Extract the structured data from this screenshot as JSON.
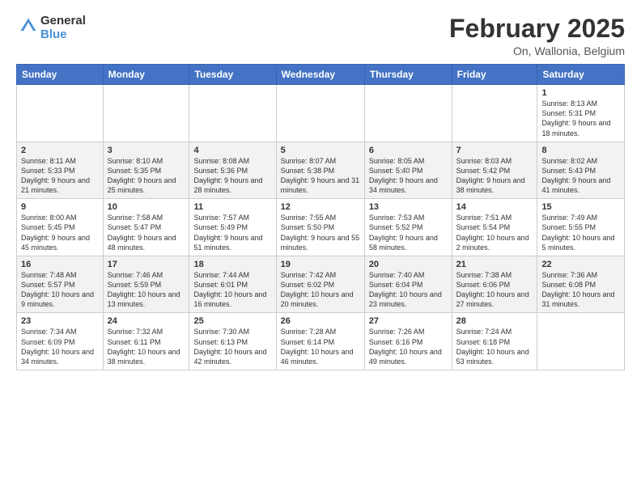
{
  "header": {
    "logo_general": "General",
    "logo_blue": "Blue",
    "month_title": "February 2025",
    "location": "On, Wallonia, Belgium"
  },
  "days_of_week": [
    "Sunday",
    "Monday",
    "Tuesday",
    "Wednesday",
    "Thursday",
    "Friday",
    "Saturday"
  ],
  "weeks": [
    [
      {
        "day": "",
        "info": ""
      },
      {
        "day": "",
        "info": ""
      },
      {
        "day": "",
        "info": ""
      },
      {
        "day": "",
        "info": ""
      },
      {
        "day": "",
        "info": ""
      },
      {
        "day": "",
        "info": ""
      },
      {
        "day": "1",
        "info": "Sunrise: 8:13 AM\nSunset: 5:31 PM\nDaylight: 9 hours and 18 minutes."
      }
    ],
    [
      {
        "day": "2",
        "info": "Sunrise: 8:11 AM\nSunset: 5:33 PM\nDaylight: 9 hours and 21 minutes."
      },
      {
        "day": "3",
        "info": "Sunrise: 8:10 AM\nSunset: 5:35 PM\nDaylight: 9 hours and 25 minutes."
      },
      {
        "day": "4",
        "info": "Sunrise: 8:08 AM\nSunset: 5:36 PM\nDaylight: 9 hours and 28 minutes."
      },
      {
        "day": "5",
        "info": "Sunrise: 8:07 AM\nSunset: 5:38 PM\nDaylight: 9 hours and 31 minutes."
      },
      {
        "day": "6",
        "info": "Sunrise: 8:05 AM\nSunset: 5:40 PM\nDaylight: 9 hours and 34 minutes."
      },
      {
        "day": "7",
        "info": "Sunrise: 8:03 AM\nSunset: 5:42 PM\nDaylight: 9 hours and 38 minutes."
      },
      {
        "day": "8",
        "info": "Sunrise: 8:02 AM\nSunset: 5:43 PM\nDaylight: 9 hours and 41 minutes."
      }
    ],
    [
      {
        "day": "9",
        "info": "Sunrise: 8:00 AM\nSunset: 5:45 PM\nDaylight: 9 hours and 45 minutes."
      },
      {
        "day": "10",
        "info": "Sunrise: 7:58 AM\nSunset: 5:47 PM\nDaylight: 9 hours and 48 minutes."
      },
      {
        "day": "11",
        "info": "Sunrise: 7:57 AM\nSunset: 5:49 PM\nDaylight: 9 hours and 51 minutes."
      },
      {
        "day": "12",
        "info": "Sunrise: 7:55 AM\nSunset: 5:50 PM\nDaylight: 9 hours and 55 minutes."
      },
      {
        "day": "13",
        "info": "Sunrise: 7:53 AM\nSunset: 5:52 PM\nDaylight: 9 hours and 58 minutes."
      },
      {
        "day": "14",
        "info": "Sunrise: 7:51 AM\nSunset: 5:54 PM\nDaylight: 10 hours and 2 minutes."
      },
      {
        "day": "15",
        "info": "Sunrise: 7:49 AM\nSunset: 5:55 PM\nDaylight: 10 hours and 5 minutes."
      }
    ],
    [
      {
        "day": "16",
        "info": "Sunrise: 7:48 AM\nSunset: 5:57 PM\nDaylight: 10 hours and 9 minutes."
      },
      {
        "day": "17",
        "info": "Sunrise: 7:46 AM\nSunset: 5:59 PM\nDaylight: 10 hours and 13 minutes."
      },
      {
        "day": "18",
        "info": "Sunrise: 7:44 AM\nSunset: 6:01 PM\nDaylight: 10 hours and 16 minutes."
      },
      {
        "day": "19",
        "info": "Sunrise: 7:42 AM\nSunset: 6:02 PM\nDaylight: 10 hours and 20 minutes."
      },
      {
        "day": "20",
        "info": "Sunrise: 7:40 AM\nSunset: 6:04 PM\nDaylight: 10 hours and 23 minutes."
      },
      {
        "day": "21",
        "info": "Sunrise: 7:38 AM\nSunset: 6:06 PM\nDaylight: 10 hours and 27 minutes."
      },
      {
        "day": "22",
        "info": "Sunrise: 7:36 AM\nSunset: 6:08 PM\nDaylight: 10 hours and 31 minutes."
      }
    ],
    [
      {
        "day": "23",
        "info": "Sunrise: 7:34 AM\nSunset: 6:09 PM\nDaylight: 10 hours and 34 minutes."
      },
      {
        "day": "24",
        "info": "Sunrise: 7:32 AM\nSunset: 6:11 PM\nDaylight: 10 hours and 38 minutes."
      },
      {
        "day": "25",
        "info": "Sunrise: 7:30 AM\nSunset: 6:13 PM\nDaylight: 10 hours and 42 minutes."
      },
      {
        "day": "26",
        "info": "Sunrise: 7:28 AM\nSunset: 6:14 PM\nDaylight: 10 hours and 46 minutes."
      },
      {
        "day": "27",
        "info": "Sunrise: 7:26 AM\nSunset: 6:16 PM\nDaylight: 10 hours and 49 minutes."
      },
      {
        "day": "28",
        "info": "Sunrise: 7:24 AM\nSunset: 6:18 PM\nDaylight: 10 hours and 53 minutes."
      },
      {
        "day": "",
        "info": ""
      }
    ]
  ]
}
